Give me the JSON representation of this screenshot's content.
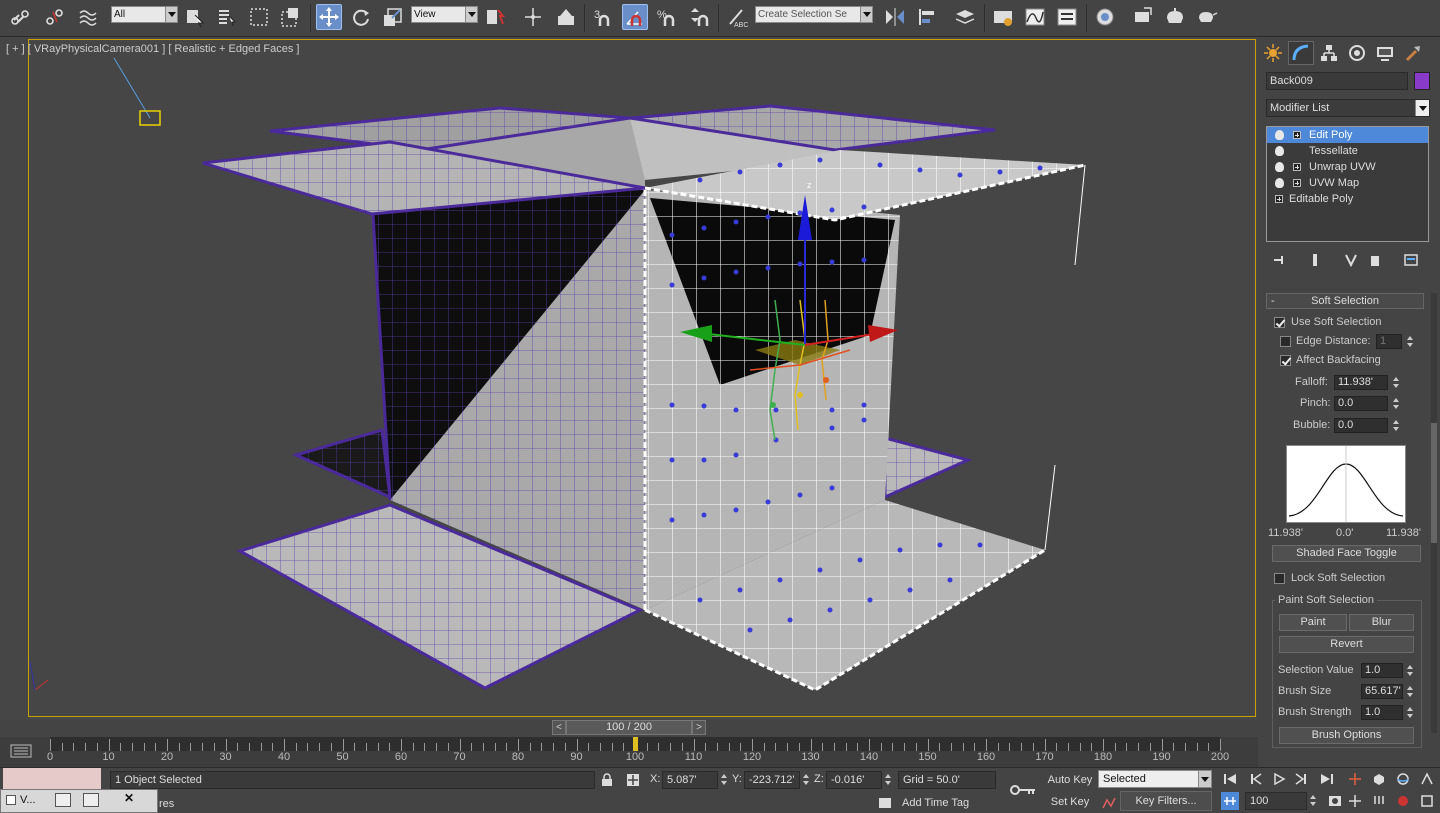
{
  "toolbar": {
    "selection_filter": "All",
    "ref_coord_system": "View",
    "named_selection_placeholder": "Create Selection Se",
    "snap_label": "3",
    "colors": {
      "accent": "#6a8fc8",
      "viewport_border": "#c9a200"
    }
  },
  "viewport": {
    "label": "[ + ] [ VRayPhysicalCamera001 ] [ Realistic + Edged Faces ]"
  },
  "command_panel": {
    "tabs": [
      "create-icon",
      "modify-icon",
      "hierarchy-icon",
      "motion-icon",
      "display-icon",
      "utilities-icon"
    ],
    "object_name": "Back009",
    "object_color": "#8a3ac8",
    "modifier_list_label": "Modifier List",
    "stack": [
      {
        "label": "Edit Poly",
        "selected": true,
        "base": false
      },
      {
        "label": "Tessellate",
        "selected": false,
        "base": false
      },
      {
        "label": "Unwrap UVW",
        "selected": false,
        "base": false
      },
      {
        "label": "UVW Map",
        "selected": false,
        "base": false
      },
      {
        "label": "Editable Poly",
        "selected": false,
        "base": true
      }
    ],
    "soft_selection": {
      "title": "Soft Selection",
      "use_soft_selection": "Use Soft Selection",
      "edge_distance": "Edge Distance:",
      "edge_distance_value": "1",
      "affect_backfacing": "Affect Backfacing",
      "falloff_label": "Falloff:",
      "falloff_value": "11.938'",
      "pinch_label": "Pinch:",
      "pinch_value": "0.0",
      "bubble_label": "Bubble:",
      "bubble_value": "0.0",
      "curve_left": "11.938'",
      "curve_mid": "0.0'",
      "curve_right": "11.938'",
      "shaded_face_toggle": "Shaded Face Toggle",
      "lock_soft_selection": "Lock Soft Selection",
      "paint_group": "Paint Soft Selection",
      "paint": "Paint",
      "blur": "Blur",
      "revert": "Revert",
      "selection_value_label": "Selection Value",
      "selection_value": "1.0",
      "brush_size_label": "Brush Size",
      "brush_size": "65.617'",
      "brush_strength_label": "Brush Strength",
      "brush_strength": "1.0",
      "brush_options": "Brush Options"
    }
  },
  "timeline": {
    "frame_display": "100 / 200",
    "prev": "<",
    "next": ">",
    "tick_labels": [
      "0",
      "10",
      "20",
      "30",
      "40",
      "50",
      "60",
      "70",
      "80",
      "90",
      "100",
      "110",
      "120",
      "130",
      "140",
      "150",
      "160",
      "170",
      "180",
      "190",
      "200"
    ],
    "current_frame": 100,
    "total_frames": 200
  },
  "status": {
    "selection_info": "1 Object Selected",
    "x_label": "X:",
    "x_value": "5.087'",
    "y_label": "Y:",
    "y_value": "-223.712'",
    "z_label": "Z:",
    "z_value": "-0.016'",
    "grid": "Grid = 50.0'",
    "add_time_tag": "Add Time Tag",
    "auto_key": "Auto Key",
    "set_key": "Set Key",
    "key_mode_value": "Selected",
    "key_filters": "Key Filters...",
    "frame_value": "100",
    "prompt_fragment": "res"
  },
  "taskbar": {
    "window_label": "V..."
  }
}
